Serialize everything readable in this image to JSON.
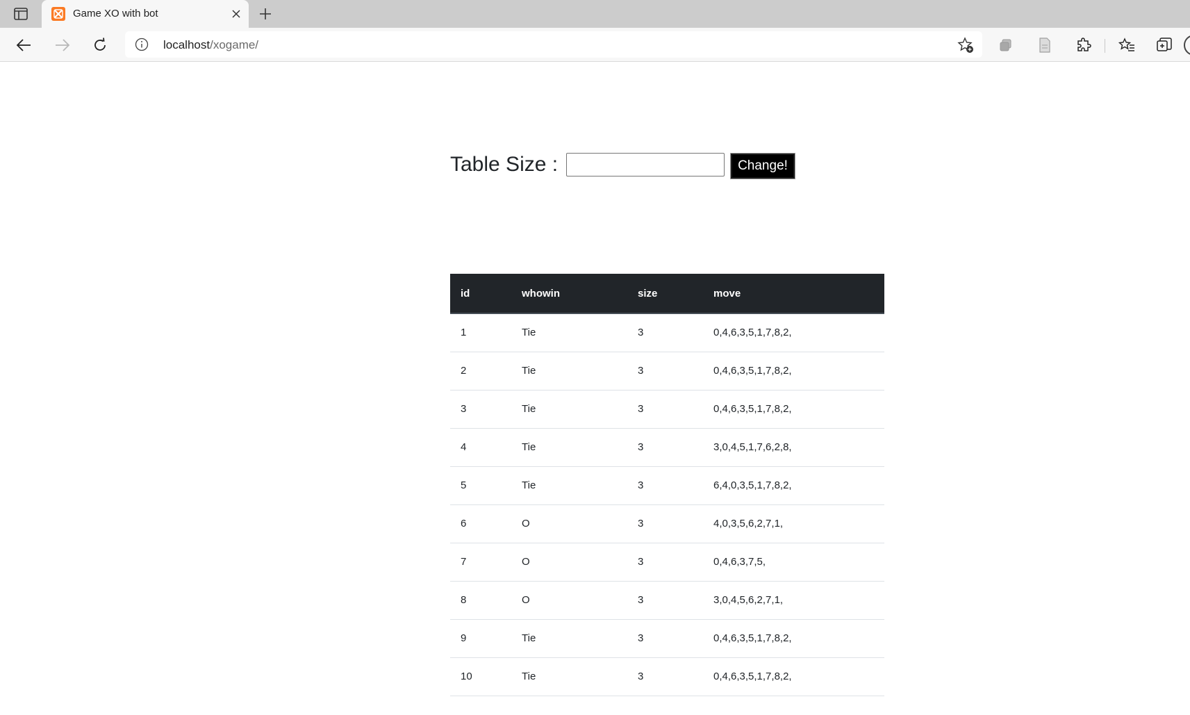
{
  "browser": {
    "tab_title": "Game XO with bot",
    "url_host": "localhost",
    "url_path": "/xogame/",
    "favicon_color": "#fb7a24"
  },
  "toolbar_icons": [
    "sidebar-toggle-icon",
    "close-icon",
    "plus-icon",
    "back-arrow-icon",
    "forward-arrow-icon",
    "reload-icon",
    "info-icon",
    "add-favorite-icon",
    "collections-icon",
    "reading-view-icon",
    "extensions-icon",
    "favorites-icon",
    "tab-actions-icon",
    "profile-icon"
  ],
  "form": {
    "label": "Table Size :",
    "input_value": "",
    "button_label": "Change!"
  },
  "table": {
    "header_color": "#212529",
    "columns": [
      "id",
      "whowin",
      "size",
      "move"
    ],
    "rows": [
      [
        "1",
        "Tie",
        "3",
        "0,4,6,3,5,1,7,8,2,"
      ],
      [
        "2",
        "Tie",
        "3",
        "0,4,6,3,5,1,7,8,2,"
      ],
      [
        "3",
        "Tie",
        "3",
        "0,4,6,3,5,1,7,8,2,"
      ],
      [
        "4",
        "Tie",
        "3",
        "3,0,4,5,1,7,6,2,8,"
      ],
      [
        "5",
        "Tie",
        "3",
        "6,4,0,3,5,1,7,8,2,"
      ],
      [
        "6",
        "O",
        "3",
        "4,0,3,5,6,2,7,1,"
      ],
      [
        "7",
        "O",
        "3",
        "0,4,6,3,7,5,"
      ],
      [
        "8",
        "O",
        "3",
        "3,0,4,5,6,2,7,1,"
      ],
      [
        "9",
        "Tie",
        "3",
        "0,4,6,3,5,1,7,8,2,"
      ],
      [
        "10",
        "Tie",
        "3",
        "0,4,6,3,5,1,7,8,2,"
      ]
    ]
  }
}
